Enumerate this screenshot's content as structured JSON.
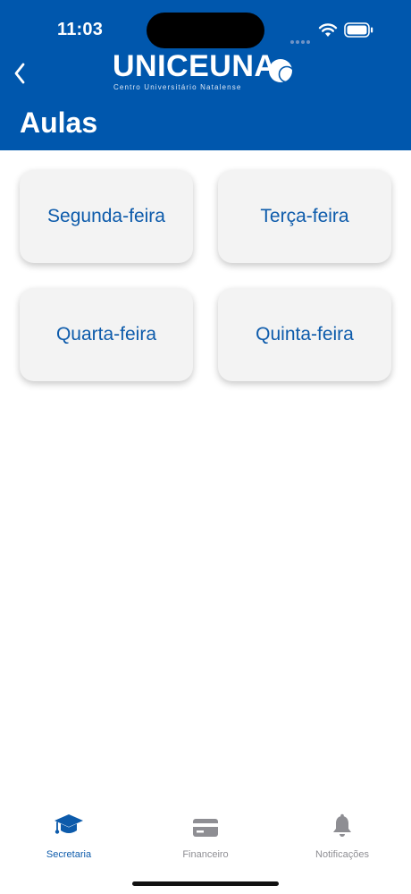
{
  "status_bar": {
    "time": "11:03"
  },
  "header": {
    "logo_text": "UNICEUNA",
    "logo_subtitle": "Centro Universitário Natalense",
    "title": "Aulas",
    "accent_color": "#0057ad"
  },
  "days": [
    {
      "label": "Segunda-feira"
    },
    {
      "label": "Terça-feira"
    },
    {
      "label": "Quarta-feira"
    },
    {
      "label": "Quinta-feira"
    }
  ],
  "tabs": [
    {
      "label": "Secretaria",
      "icon": "graduation-cap-icon",
      "active": true
    },
    {
      "label": "Financeiro",
      "icon": "credit-card-icon",
      "active": false
    },
    {
      "label": "Notificações",
      "icon": "bell-icon",
      "active": false
    }
  ]
}
